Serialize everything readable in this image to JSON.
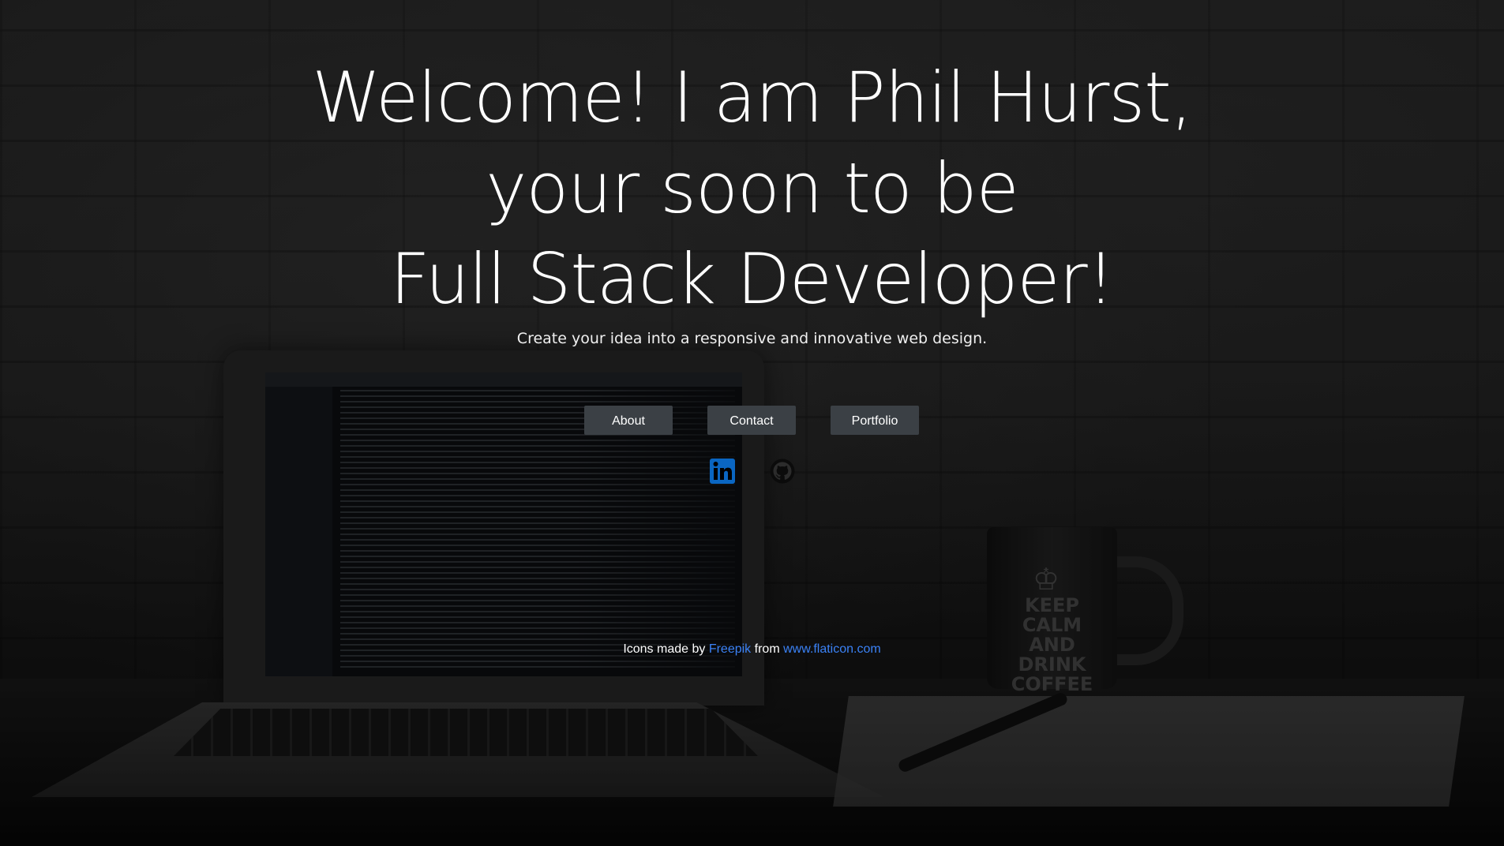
{
  "hero": {
    "title_line1": "Welcome! I am Phil Hurst,",
    "title_line2": "your soon to be",
    "title_line3": "Full Stack Developer!",
    "subtitle": "Create your idea into a responsive and innovative web design."
  },
  "nav": {
    "about_label": "About",
    "contact_label": "Contact",
    "portfolio_label": "Portfolio"
  },
  "social": {
    "linkedin_icon": "linkedin-icon",
    "github_icon": "github-icon",
    "linkedin_color": "#0a66c2",
    "github_color": "#0b0b0b"
  },
  "credits": {
    "prefix": "Icons made by",
    "author_link": "Freepik",
    "middle": "from",
    "site_link": "www.flaticon.com"
  },
  "background": {
    "mug_text": "KEEP CALM AND DRINK COFFEE"
  },
  "colors": {
    "button_bg": "#3b4045",
    "link": "#3b82f6",
    "text": "#ffffff"
  }
}
